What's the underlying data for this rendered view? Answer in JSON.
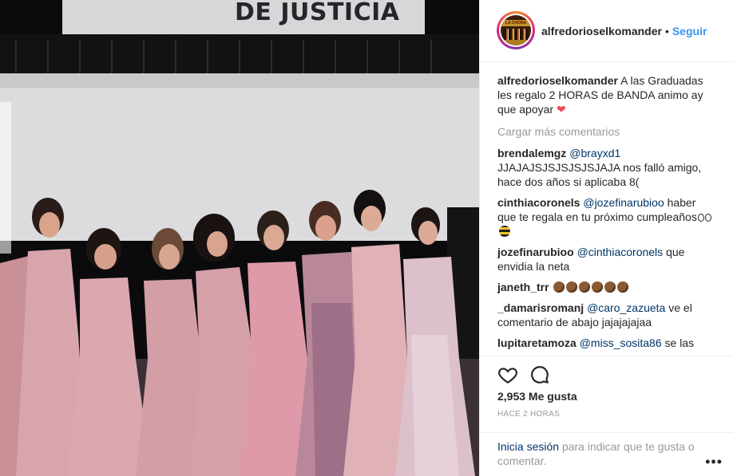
{
  "photo": {
    "sign_text": "DE JUSTICIA",
    "description_colors": {
      "wall": "#dcdcde",
      "dress": "#d9a7ad",
      "background": "#0b0b0d"
    }
  },
  "post": {
    "username": "alfredorioselkomander",
    "separator": "•",
    "follow_label": "Seguir",
    "avatar_icon": "band-logo-avatar",
    "avatar_text": "LA CHONA"
  },
  "caption": {
    "username": "alfredorioselkomander",
    "text": "A las Graduadas les regalo 2 HORAS de BANDA animo ay que apoyar",
    "emoji": "heart-icon"
  },
  "load_more": "Cargar más comentarios",
  "comments": [
    {
      "username": "brendalemgz",
      "mention": "@brayxd1",
      "text": "JJAJAJSJSJSJSJSJAJA nos falló amigo, hace dos años si aplicaba 8("
    },
    {
      "username": "cinthiacoronels",
      "mention": "@jozefinarubioo",
      "text": "haber que te regala en tu próximo cumpleaños"
    },
    {
      "username": "jozefinarubioo",
      "mention": "@cinthiacoronels",
      "text": "que envidia la neta"
    },
    {
      "username": "janeth_trr",
      "mention": "",
      "text": ""
    },
    {
      "username": "_damarisromanj",
      "mention": "@caro_zazueta",
      "text": "ve el comentario de abajo jajajajajaa"
    },
    {
      "username": "lupitaretamoza",
      "mention": "@miss_sosita86",
      "text": "se las esta regalando a las muchachas de enfermeria que se quedaron sin fiesta xk las estafaron"
    }
  ],
  "actions": {
    "like_icon": "heart-outline-icon",
    "comment_icon": "comment-bubble-icon",
    "likes": "2,953 Me gusta",
    "time": "HACE 2 HORAS"
  },
  "login_prompt": {
    "link": "Inicia sesión",
    "text": "para indicar que te gusta o comentar."
  },
  "more_icon": "more-options-icon"
}
